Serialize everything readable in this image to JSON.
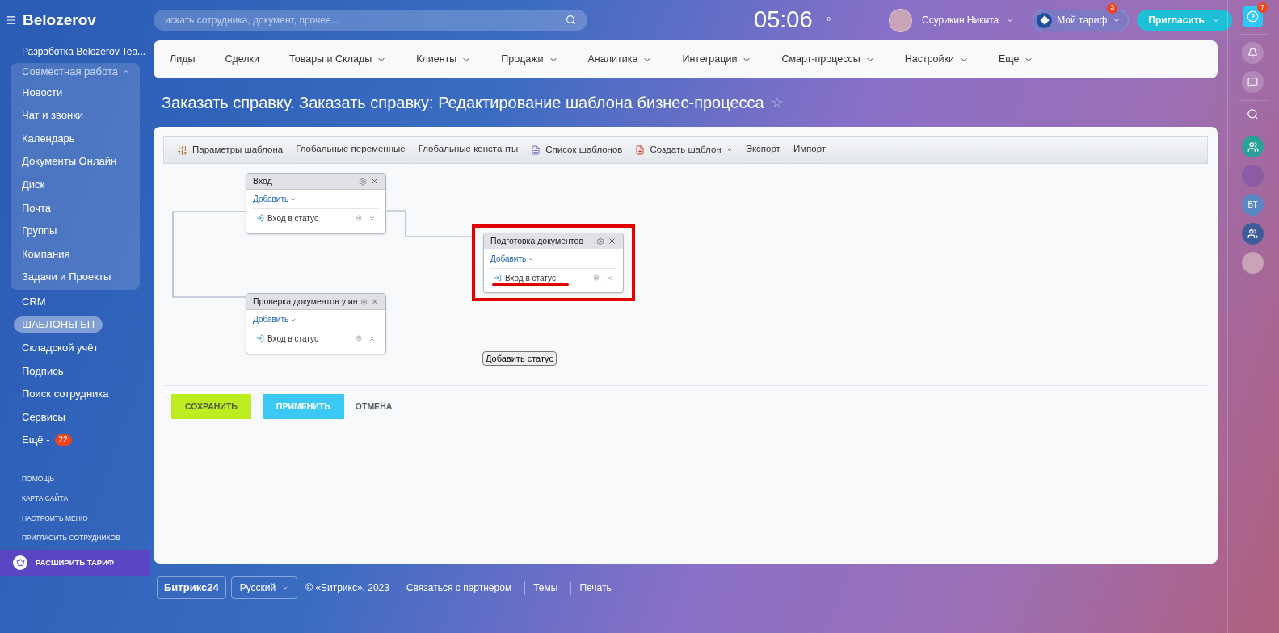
{
  "header": {
    "logo": "Belozerov",
    "search": {
      "placeholder": "искать сотрудника, документ, прочее..."
    },
    "clock": "05:06",
    "flag_count": "0",
    "user_name": "Ссурикин Никита",
    "tariff": {
      "label": "Мой тариф",
      "badge": "3"
    },
    "invite": "Пригласить"
  },
  "sidebar": {
    "workspace": "Разработка Belozerov Tea...",
    "group": {
      "label": "Совместная работа",
      "expanded": true,
      "items": [
        {
          "label": "Новости"
        },
        {
          "label": "Чат и звонки"
        },
        {
          "label": "Календарь"
        },
        {
          "label": "Документы Онлайн"
        },
        {
          "label": "Диск"
        },
        {
          "label": "Почта"
        },
        {
          "label": "Группы"
        },
        {
          "label": "Компания"
        },
        {
          "label": "Задачи и Проекты"
        }
      ]
    },
    "items": [
      {
        "label": "CRM",
        "selected": false
      },
      {
        "label": "ШАБЛОНЫ БП",
        "selected": true
      },
      {
        "label": "Складской учёт",
        "selected": false
      },
      {
        "label": "Подпись",
        "selected": false
      },
      {
        "label": "Поиск сотрудника",
        "selected": false
      },
      {
        "label": "Сервисы",
        "selected": false
      }
    ],
    "more": {
      "label": "Ещё -",
      "badge": "22"
    },
    "links": [
      "ПОМОЩЬ",
      "КАРТА САЙТА",
      "НАСТРОИТЬ МЕНЮ",
      "ПРИГЛАСИТЬ СОТРУДНИКОВ"
    ],
    "upgrade": "РАСШИРИТЬ ТАРИФ"
  },
  "top_menu": [
    {
      "label": "Лиды",
      "dropdown": false
    },
    {
      "label": "Сделки",
      "dropdown": false
    },
    {
      "label": "Товары и Склады",
      "dropdown": true
    },
    {
      "label": "Клиенты",
      "dropdown": true
    },
    {
      "label": "Продажи",
      "dropdown": true
    },
    {
      "label": "Аналитика",
      "dropdown": true
    },
    {
      "label": "Интеграции",
      "dropdown": true
    },
    {
      "label": "Смарт-процессы",
      "dropdown": true
    },
    {
      "label": "Настройки",
      "dropdown": true
    },
    {
      "label": "Еще",
      "dropdown": true
    }
  ],
  "page_title": "Заказать справку. Заказать справку: Редактирование шаблона бизнес-процесса",
  "title_star": "☆",
  "toolbar": [
    {
      "label": "Параметры шаблона",
      "kind": "settings"
    },
    {
      "label": "Глобальные переменные",
      "kind": "plain"
    },
    {
      "label": "Глобальные константы",
      "kind": "plain"
    },
    {
      "label": "Список шаблонов",
      "kind": "list"
    },
    {
      "label": "Создать шаблон",
      "kind": "create"
    },
    {
      "label": "Экспорт",
      "kind": "plain"
    },
    {
      "label": "Импорт",
      "kind": "plain"
    }
  ],
  "nodes": [
    {
      "title": "Вход",
      "add": "Добавить",
      "action": "Вход в статус",
      "highlighted": false
    },
    {
      "title": "Подготовка документов",
      "add": "Добавить",
      "action": "Вход в статус",
      "highlighted": true
    },
    {
      "title": "Проверка документов у ин",
      "add": "Добавить",
      "action": "Вход в статус",
      "highlighted": false
    }
  ],
  "add_status": "Добавить статус",
  "buttons": {
    "save": "СОХРАНИТЬ",
    "apply": "ПРИМЕНИТЬ",
    "cancel": "ОТМЕНА"
  },
  "right_bar": {
    "help_badge": "7",
    "contact_initials": "БТ"
  },
  "footer": {
    "brand": "Битрикс24",
    "language": "Русский",
    "copyright": "© «Битрикс», 2023",
    "links": [
      "Связаться с партнером",
      "Темы",
      "Печать"
    ]
  }
}
